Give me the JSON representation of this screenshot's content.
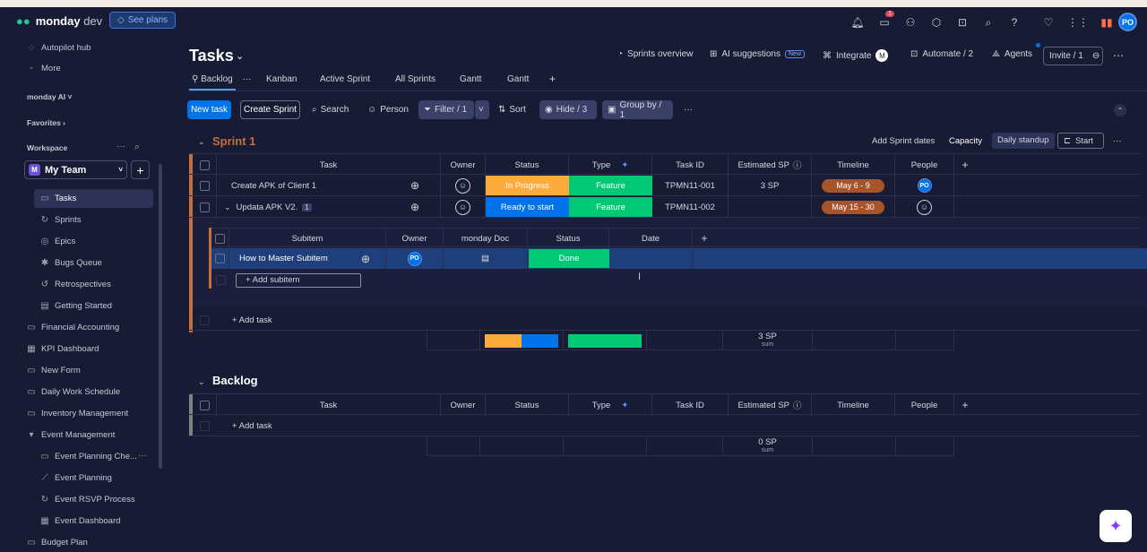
{
  "app": {
    "logo_word": "monday",
    "logo_suffix": "dev",
    "see_plans": "See plans",
    "inbox_count": "1",
    "user_initials": "PO"
  },
  "sidebar": {
    "top_items": [
      {
        "label": "Autopilot hub"
      },
      {
        "label": "More"
      }
    ],
    "monday_ai": "monday AI",
    "favorites": "Favorites",
    "workspace_label": "Workspace",
    "workspace_initial": "M",
    "workspace_name": "My Team",
    "team_items": [
      {
        "label": "Tasks"
      },
      {
        "label": "Sprints"
      },
      {
        "label": "Epics"
      },
      {
        "label": "Bugs Queue"
      },
      {
        "label": "Retrospectives"
      },
      {
        "label": "Getting Started"
      }
    ],
    "boards": [
      {
        "label": "Financial Accounting"
      },
      {
        "label": "KPI Dashboard"
      },
      {
        "label": "New Form"
      },
      {
        "label": "Daily Work Schedule"
      },
      {
        "label": "Inventory Management"
      },
      {
        "label": "Event Management"
      }
    ],
    "event_items": [
      {
        "label": "Event Planning Che..."
      },
      {
        "label": "Event Planning"
      },
      {
        "label": "Event RSVP Process"
      },
      {
        "label": "Event Dashboard"
      }
    ],
    "budget": "Budget Plan"
  },
  "header": {
    "title": "Tasks",
    "sprints_overview": "Sprints overview",
    "ai_suggestions": "AI suggestions",
    "new_badge": "New",
    "integrate": "Integrate",
    "automate": "Automate / 2",
    "agents": "Agents",
    "invite": "Invite / 1"
  },
  "tabs": [
    {
      "label": "Backlog"
    },
    {
      "label": "Kanban"
    },
    {
      "label": "Active Sprint"
    },
    {
      "label": "All Sprints"
    },
    {
      "label": "Gantt"
    },
    {
      "label": "Gantt"
    }
  ],
  "toolbar": {
    "new_task": "New task",
    "create_sprint": "Create Sprint",
    "search": "Search",
    "person": "Person",
    "filter": "Filter / 1",
    "sort": "Sort",
    "hide": "Hide / 3",
    "group_by": "Group by / 1"
  },
  "sprint": {
    "title": "Sprint 1",
    "add_dates": "Add Sprint dates",
    "capacity": "Capacity",
    "daily_standup": "Daily standup",
    "start": "Start",
    "columns": {
      "task": "Task",
      "owner": "Owner",
      "status": "Status",
      "type": "Type",
      "task_id": "Task ID",
      "est_sp": "Estimated SP",
      "timeline": "Timeline",
      "people": "People"
    },
    "rows": [
      {
        "task": "Create APK of Client 1",
        "status": "In Progress",
        "type": "Feature",
        "task_id": "TPMN11-001",
        "sp": "3 SP",
        "timeline": "May 6 - 9",
        "people": "PO"
      },
      {
        "task": "Updata APK V2.",
        "sub_count": "1",
        "status": "Ready to start",
        "type": "Feature",
        "task_id": "TPMN11-002",
        "sp": "",
        "timeline": "May 15 - 30",
        "people": ""
      }
    ],
    "subitems": {
      "columns": {
        "subitem": "Subitem",
        "owner": "Owner",
        "doc": "monday Doc",
        "status": "Status",
        "date": "Date"
      },
      "rows": [
        {
          "name": "How to Master Subitem",
          "owner": "PO",
          "status": "Done"
        }
      ],
      "add_label": "+ Add subitem"
    },
    "add_task": "+ Add task",
    "sum_value": "3 SP",
    "sum_label": "sum"
  },
  "backlog": {
    "title": "Backlog",
    "add_task": "+ Add task",
    "sum_value": "0 SP",
    "sum_label": "sum"
  },
  "colors": {
    "accent": "#0073ea",
    "in_progress": "#fdab3d",
    "ready": "#0073ea",
    "feature": "#00c875",
    "done": "#00c875",
    "sprint_color": "#c56e3e",
    "timeline": "#a8542b"
  }
}
